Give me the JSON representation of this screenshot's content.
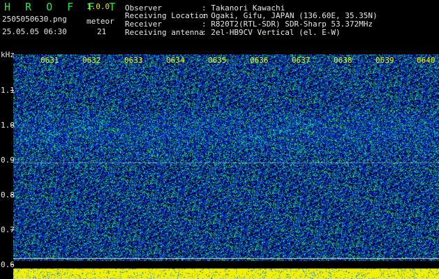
{
  "header": {
    "brand": "H R O F F T",
    "version": "1.0.0",
    "filename": "2505050630.png",
    "datetime": "25.05.05 06:30",
    "meteor_label": "meteor",
    "meteor_count": "21",
    "fields": [
      {
        "label": "Observer",
        "value": ": Takanori Kawachi"
      },
      {
        "label": "Receiving Location",
        "value": ": Ogaki, Gifu, JAPAN (136.60E, 35.35N)"
      },
      {
        "label": "Receiver",
        "value": ": R820T2(RTL-SDR) SDR-Sharp 53.372MHz"
      },
      {
        "label": "Receiving antenna",
        "value": ": 2el-HB9CV Vertical (el. E-W)"
      }
    ]
  },
  "spectrogram": {
    "y_unit": "kHz",
    "y_ticks": [
      "1.1",
      "1.0",
      "0.9",
      "0.8",
      "0.7",
      "0.6"
    ],
    "time_ticks": [
      "0631",
      "0632",
      "0633",
      "0634",
      "0635",
      "0636",
      "0637",
      "0638",
      "0639",
      "0640"
    ],
    "colors": {
      "marker": "#f0f000",
      "trace": "#22e84a",
      "background": "#000"
    }
  }
}
